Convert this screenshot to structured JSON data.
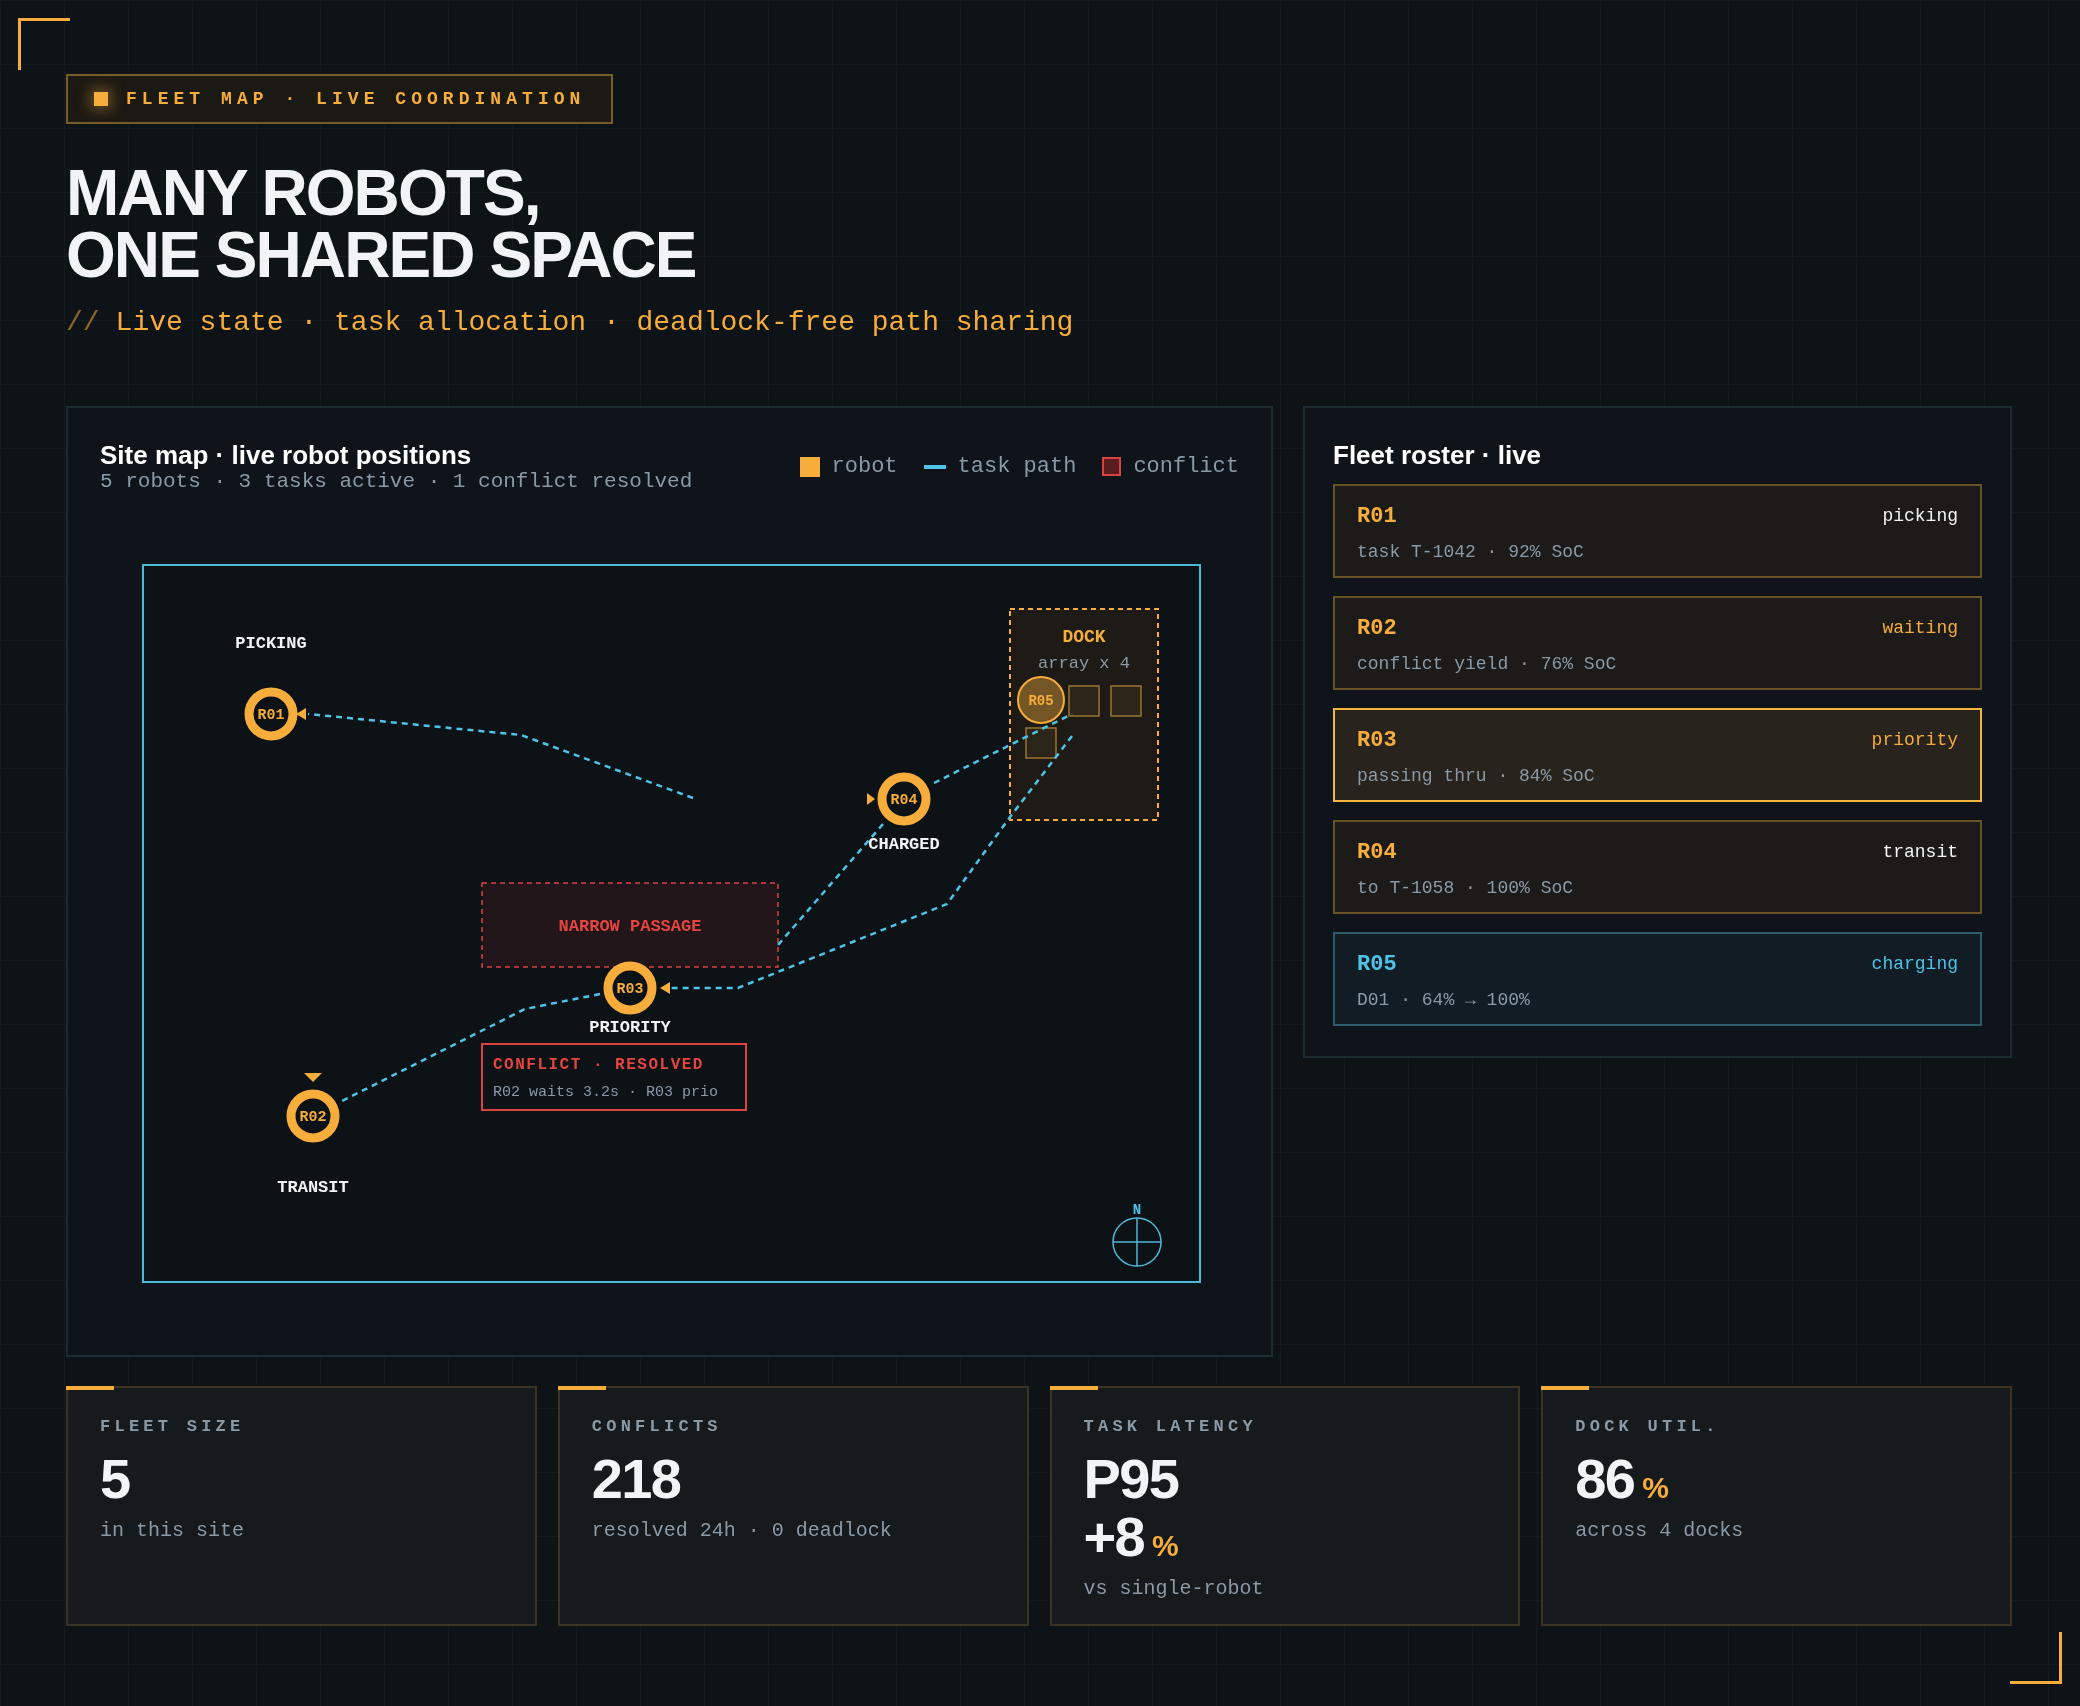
{
  "header": {
    "badge": "FLEET MAP · LIVE COORDINATION",
    "title_lines": [
      "MANY ROBOTS,",
      "ONE SHARED SPACE"
    ],
    "subtitle_prefix": "//",
    "subtitle": "Live state · task allocation · deadlock-free path sharing"
  },
  "site_map": {
    "title": "Site map · live robot positions",
    "subtitle": "5 robots · 3 tasks active · 1 conflict resolved",
    "legend": [
      {
        "kind": "robot",
        "label": "robot"
      },
      {
        "kind": "path",
        "label": "task path"
      },
      {
        "kind": "conflict",
        "label": "conflict"
      }
    ],
    "robots": [
      {
        "id": "R01",
        "label": "PICKING",
        "kind": "active"
      },
      {
        "id": "R02",
        "label": "TRANSIT",
        "kind": "active"
      },
      {
        "id": "R03",
        "label": "PRIORITY",
        "kind": "active"
      },
      {
        "id": "R04",
        "label": "CHARGED",
        "kind": "active"
      },
      {
        "id": "R05",
        "kind": "docked"
      }
    ],
    "dock": {
      "title": "DOCK",
      "caption": "array x 4"
    },
    "narrow_passage": "NARROW PASSAGE",
    "conflict": {
      "title": "CONFLICT · RESOLVED",
      "detail": "R02 waits 3.2s · R03 prio"
    },
    "compass": "N"
  },
  "roster": {
    "title": "Fleet roster · live",
    "items": [
      {
        "id": "R01",
        "detail": "task T-1042 · 92% SoC",
        "status": "picking",
        "color": "#f1f3f6",
        "selected": false
      },
      {
        "id": "R02",
        "detail": "conflict yield · 76% SoC",
        "status": "waiting",
        "color": "#f6ad3c",
        "selected": false
      },
      {
        "id": "R03",
        "detail": "passing thru · 84% SoC",
        "status": "priority",
        "color": "#f6ad3c",
        "selected": true
      },
      {
        "id": "R04",
        "detail": "to T-1058 · 100% SoC",
        "status": "transit",
        "color": "#f1f3f6",
        "selected": false
      },
      {
        "id": "R05",
        "detail": "D01 · 64% → 100%",
        "status": "charging",
        "color": "#4fc3e8",
        "selected": false
      }
    ]
  },
  "stats": [
    {
      "label": "FLEET SIZE",
      "values": [
        {
          "text": "5"
        }
      ],
      "caption": "in this site"
    },
    {
      "label": "CONFLICTS",
      "values": [
        {
          "text": "218"
        }
      ],
      "caption": "resolved 24h · 0 deadlock"
    },
    {
      "label": "TASK LATENCY",
      "values": [
        {
          "text": "P95"
        },
        {
          "text": "+8",
          "unit": "%"
        }
      ],
      "caption": "vs single-robot"
    },
    {
      "label": "DOCK UTIL.",
      "values": [
        {
          "text": "86",
          "unit": "%"
        }
      ],
      "caption": "across 4 docks"
    }
  ]
}
